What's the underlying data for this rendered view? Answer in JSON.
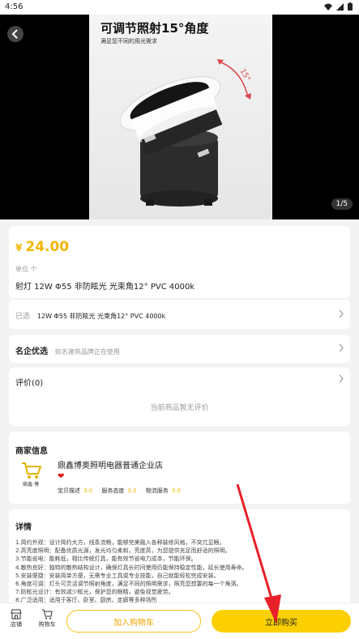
{
  "status_bar": {
    "time": "4:56"
  },
  "hero": {
    "headline": "可调节照射15°角度",
    "subline": "满足您不同的用光需求",
    "angle_label": "15°",
    "pager": "1/5"
  },
  "product": {
    "currency": "¥",
    "price": "24.00",
    "unit": "单位 个",
    "title": "射灯 12W Φ55 非防眩光 光束角12° PVC 4000k"
  },
  "selection": {
    "label": "已选",
    "value": "12W Φ55 非防眩光 光束角12° PVC 4000k"
  },
  "brand": {
    "label": "名企优选",
    "value": "知名建筑品牌正在使用"
  },
  "reviews": {
    "label": "评价(0)",
    "empty_text": "当前商品暂无评价"
  },
  "merchant": {
    "section_title": "商家信息",
    "logo_text": "鼎鑫·博",
    "name": "鼎鑫博奥照明电器普通企业店",
    "scores": [
      {
        "label": "宝贝描述",
        "value": "3.0"
      },
      {
        "label": "服务态度",
        "value": "3.0"
      },
      {
        "label": "物流服务",
        "value": "3.0"
      }
    ]
  },
  "details": {
    "title": "详情",
    "lines": [
      "1.简约外观：设计简约大方，线条流畅，能够完美融入各种装修风格，不突兀显眼。",
      "2.高亮度照明：配备优质光源，发光均匀柔和，亮度高，为您提供充足而舒适的照明。",
      "3.节能省电：能耗低，相比传统灯具，能有效节省电力成本，节能环保。",
      "4.散热良好：独特的散热结构设计，确保灯具长时间使用仍能保持稳定性能，延长使用寿命。",
      "5.安装便捷：安装简单方便，无需专业工具或专业技能，自己就能轻松完成安装。",
      "6.角度可调：灯头可灵活调节照射角度，满足不同的照明需求，照亮您想要的每一个角落。",
      "7.防眩光设计：有效减少眩光，保护您的眼睛，避免视觉疲劳。",
      "8.广泛适用：适用于客厅、卧室、厨房、走廊等多种场所"
    ]
  },
  "bottom_bar": {
    "store_label": "店铺",
    "cart_label": "购物车",
    "add_to_cart": "加入购物车",
    "buy_now": "立即购买"
  },
  "colors": {
    "accent": "#f6b500",
    "buy_button": "#fcd000",
    "annotation_arrow": "#e8202a"
  }
}
